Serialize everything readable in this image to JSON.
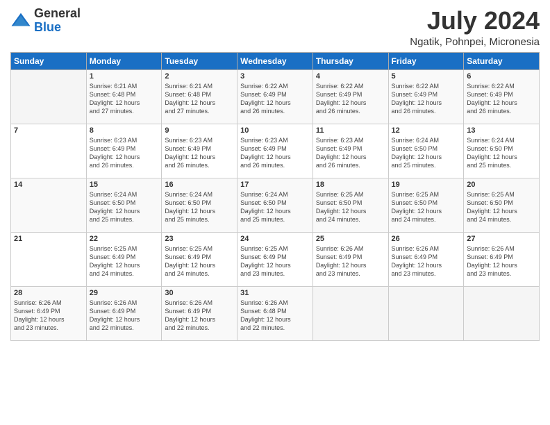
{
  "header": {
    "logo_general": "General",
    "logo_blue": "Blue",
    "month_year": "July 2024",
    "location": "Ngatik, Pohnpei, Micronesia"
  },
  "calendar": {
    "days_of_week": [
      "Sunday",
      "Monday",
      "Tuesday",
      "Wednesday",
      "Thursday",
      "Friday",
      "Saturday"
    ],
    "weeks": [
      [
        {
          "day": "",
          "info": ""
        },
        {
          "day": "1",
          "info": "Sunrise: 6:21 AM\nSunset: 6:48 PM\nDaylight: 12 hours\nand 27 minutes."
        },
        {
          "day": "2",
          "info": "Sunrise: 6:21 AM\nSunset: 6:48 PM\nDaylight: 12 hours\nand 27 minutes."
        },
        {
          "day": "3",
          "info": "Sunrise: 6:22 AM\nSunset: 6:49 PM\nDaylight: 12 hours\nand 26 minutes."
        },
        {
          "day": "4",
          "info": "Sunrise: 6:22 AM\nSunset: 6:49 PM\nDaylight: 12 hours\nand 26 minutes."
        },
        {
          "day": "5",
          "info": "Sunrise: 6:22 AM\nSunset: 6:49 PM\nDaylight: 12 hours\nand 26 minutes."
        },
        {
          "day": "6",
          "info": "Sunrise: 6:22 AM\nSunset: 6:49 PM\nDaylight: 12 hours\nand 26 minutes."
        }
      ],
      [
        {
          "day": "7",
          "info": ""
        },
        {
          "day": "8",
          "info": "Sunrise: 6:23 AM\nSunset: 6:49 PM\nDaylight: 12 hours\nand 26 minutes."
        },
        {
          "day": "9",
          "info": "Sunrise: 6:23 AM\nSunset: 6:49 PM\nDaylight: 12 hours\nand 26 minutes."
        },
        {
          "day": "10",
          "info": "Sunrise: 6:23 AM\nSunset: 6:49 PM\nDaylight: 12 hours\nand 26 minutes."
        },
        {
          "day": "11",
          "info": "Sunrise: 6:23 AM\nSunset: 6:49 PM\nDaylight: 12 hours\nand 26 minutes."
        },
        {
          "day": "12",
          "info": "Sunrise: 6:24 AM\nSunset: 6:50 PM\nDaylight: 12 hours\nand 25 minutes."
        },
        {
          "day": "13",
          "info": "Sunrise: 6:24 AM\nSunset: 6:50 PM\nDaylight: 12 hours\nand 25 minutes."
        }
      ],
      [
        {
          "day": "14",
          "info": ""
        },
        {
          "day": "15",
          "info": "Sunrise: 6:24 AM\nSunset: 6:50 PM\nDaylight: 12 hours\nand 25 minutes."
        },
        {
          "day": "16",
          "info": "Sunrise: 6:24 AM\nSunset: 6:50 PM\nDaylight: 12 hours\nand 25 minutes."
        },
        {
          "day": "17",
          "info": "Sunrise: 6:24 AM\nSunset: 6:50 PM\nDaylight: 12 hours\nand 25 minutes."
        },
        {
          "day": "18",
          "info": "Sunrise: 6:25 AM\nSunset: 6:50 PM\nDaylight: 12 hours\nand 24 minutes."
        },
        {
          "day": "19",
          "info": "Sunrise: 6:25 AM\nSunset: 6:50 PM\nDaylight: 12 hours\nand 24 minutes."
        },
        {
          "day": "20",
          "info": "Sunrise: 6:25 AM\nSunset: 6:50 PM\nDaylight: 12 hours\nand 24 minutes."
        }
      ],
      [
        {
          "day": "21",
          "info": ""
        },
        {
          "day": "22",
          "info": "Sunrise: 6:25 AM\nSunset: 6:49 PM\nDaylight: 12 hours\nand 24 minutes."
        },
        {
          "day": "23",
          "info": "Sunrise: 6:25 AM\nSunset: 6:49 PM\nDaylight: 12 hours\nand 24 minutes."
        },
        {
          "day": "24",
          "info": "Sunrise: 6:25 AM\nSunset: 6:49 PM\nDaylight: 12 hours\nand 23 minutes."
        },
        {
          "day": "25",
          "info": "Sunrise: 6:26 AM\nSunset: 6:49 PM\nDaylight: 12 hours\nand 23 minutes."
        },
        {
          "day": "26",
          "info": "Sunrise: 6:26 AM\nSunset: 6:49 PM\nDaylight: 12 hours\nand 23 minutes."
        },
        {
          "day": "27",
          "info": "Sunrise: 6:26 AM\nSunset: 6:49 PM\nDaylight: 12 hours\nand 23 minutes."
        }
      ],
      [
        {
          "day": "28",
          "info": "Sunrise: 6:26 AM\nSunset: 6:49 PM\nDaylight: 12 hours\nand 23 minutes."
        },
        {
          "day": "29",
          "info": "Sunrise: 6:26 AM\nSunset: 6:49 PM\nDaylight: 12 hours\nand 22 minutes."
        },
        {
          "day": "30",
          "info": "Sunrise: 6:26 AM\nSunset: 6:49 PM\nDaylight: 12 hours\nand 22 minutes."
        },
        {
          "day": "31",
          "info": "Sunrise: 6:26 AM\nSunset: 6:48 PM\nDaylight: 12 hours\nand 22 minutes."
        },
        {
          "day": "",
          "info": ""
        },
        {
          "day": "",
          "info": ""
        },
        {
          "day": "",
          "info": ""
        }
      ]
    ]
  }
}
